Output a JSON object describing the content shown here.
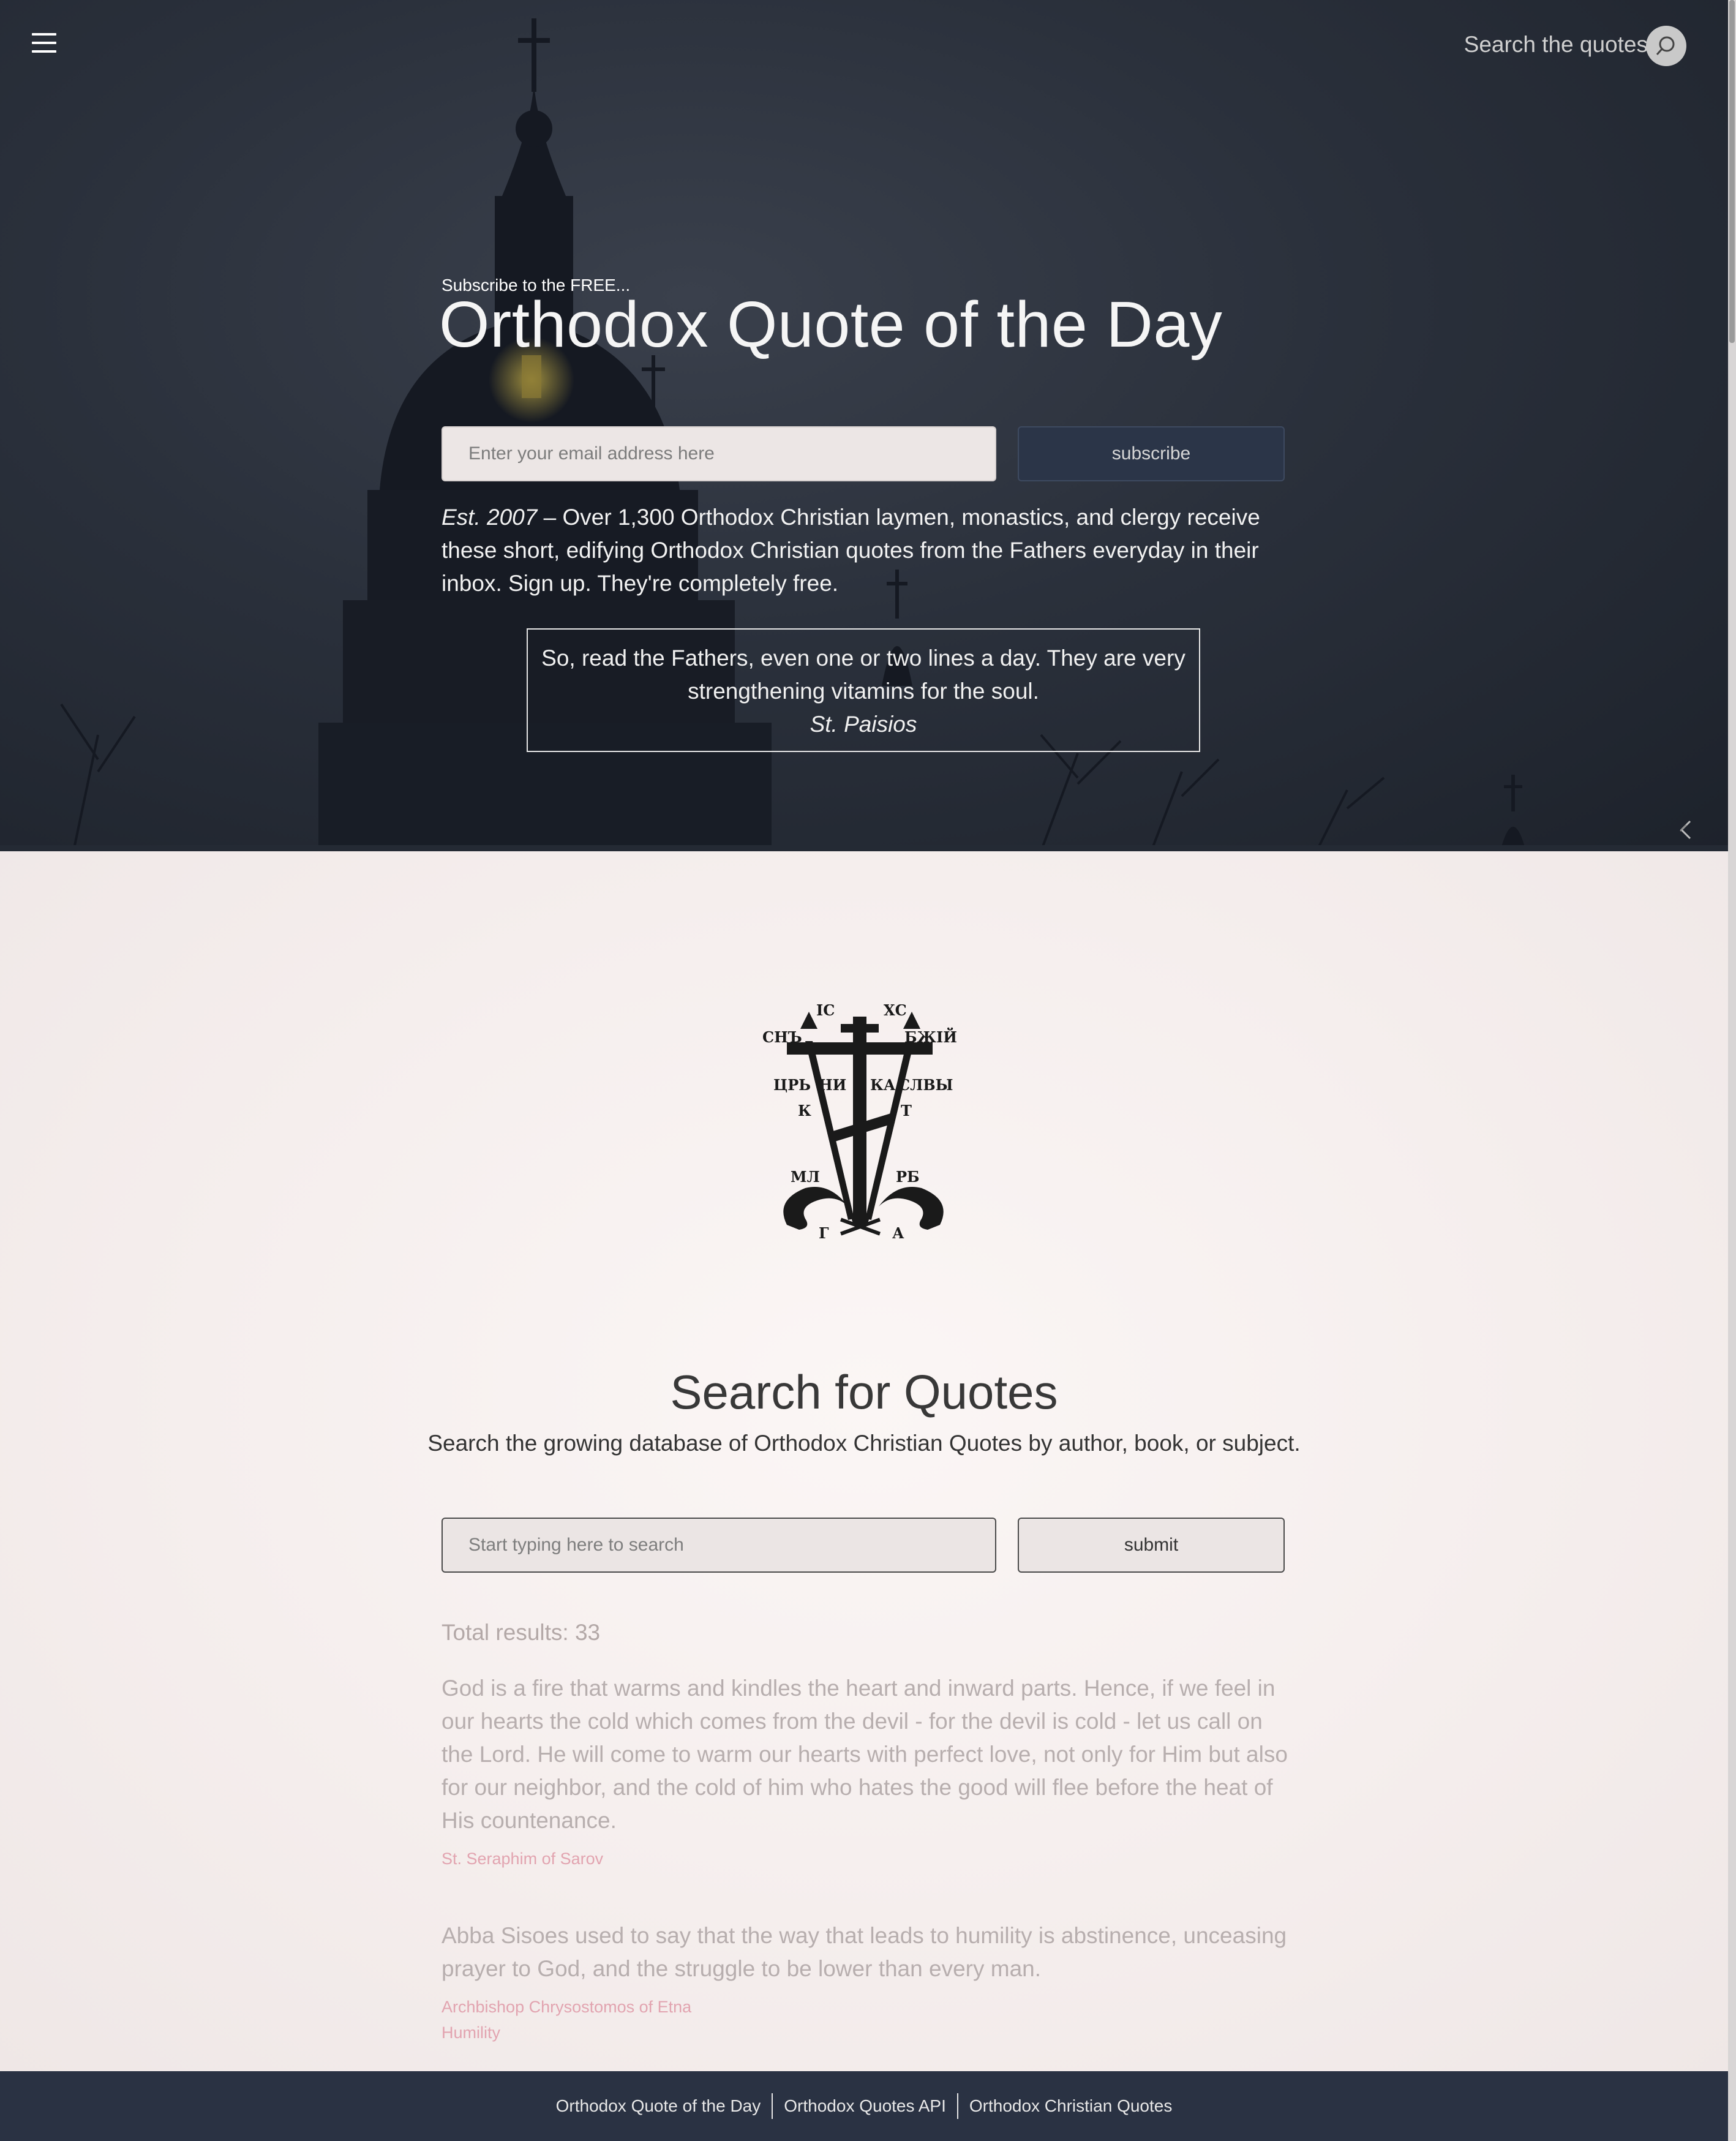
{
  "header": {
    "menu_icon": "hamburger-menu-icon",
    "search_label": "Search the quotes",
    "search_icon": "magnifier-icon"
  },
  "hero": {
    "kicker": "Subscribe to the FREE...",
    "title": "Orthodox Quote of the Day",
    "email_placeholder": "Enter your email address here",
    "subscribe_label": "subscribe",
    "est_label": "Est. 2007",
    "est_text": " – Over 1,300 Orthodox Christian laymen, monastics, and clergy receive these short, edifying Orthodox Christian quotes from the Fathers everyday in their inbox. Sign up. They're completely free.",
    "quote_text": "So, read the Fathers, even one or two lines a day. They are very strengthening vitamins for the soul.",
    "quote_author": "St. Paisios"
  },
  "emblem": {
    "top_left": "ІС",
    "top_right": "ХС",
    "left_bar": "СНЪ",
    "right_bar": "БЖІЙ",
    "mid_left1": "ЦРЬ",
    "mid_left2": "НИ",
    "mid_right1": "КА",
    "mid_right2": "СЛВЫ",
    "k": "К",
    "t": "Т",
    "ml": "МЛ",
    "rb": "РБ",
    "g": "Г",
    "a": "А"
  },
  "search": {
    "title": "Search for Quotes",
    "subtitle": "Search the growing database of Orthodox Christian Quotes by author, book, or subject.",
    "placeholder": "Start typing here to search",
    "submit_label": "submit",
    "total": "Total results: 33"
  },
  "results": [
    {
      "text": "God is a fire that warms and kindles the heart and inward parts. Hence, if we feel in our hearts the cold which comes from the devil - for the devil is cold - let us call on the Lord. He will come to warm our hearts with perfect love, not only for Him but also for our neighbor, and the cold of him who hates the good will flee before the heat of His countenance.",
      "author": "St. Seraphim of Sarov"
    },
    {
      "text": "Abba Sisoes used to say that the way that leads to humility is abstinence, unceasing prayer to God, and the struggle to be lower than every man.",
      "author": "Archbishop Chrysostomos of Etna",
      "subject": "Humility"
    }
  ],
  "footer": {
    "links": [
      "Orthodox Quote of the Day",
      "Orthodox Quotes API",
      "Orthodox Christian Quotes"
    ]
  },
  "colors": {
    "hero_bg": "#2a303b",
    "button_dark": "#2b3548",
    "footer_bg": "#2a3243",
    "meta_pink": "#e2a4b0"
  }
}
